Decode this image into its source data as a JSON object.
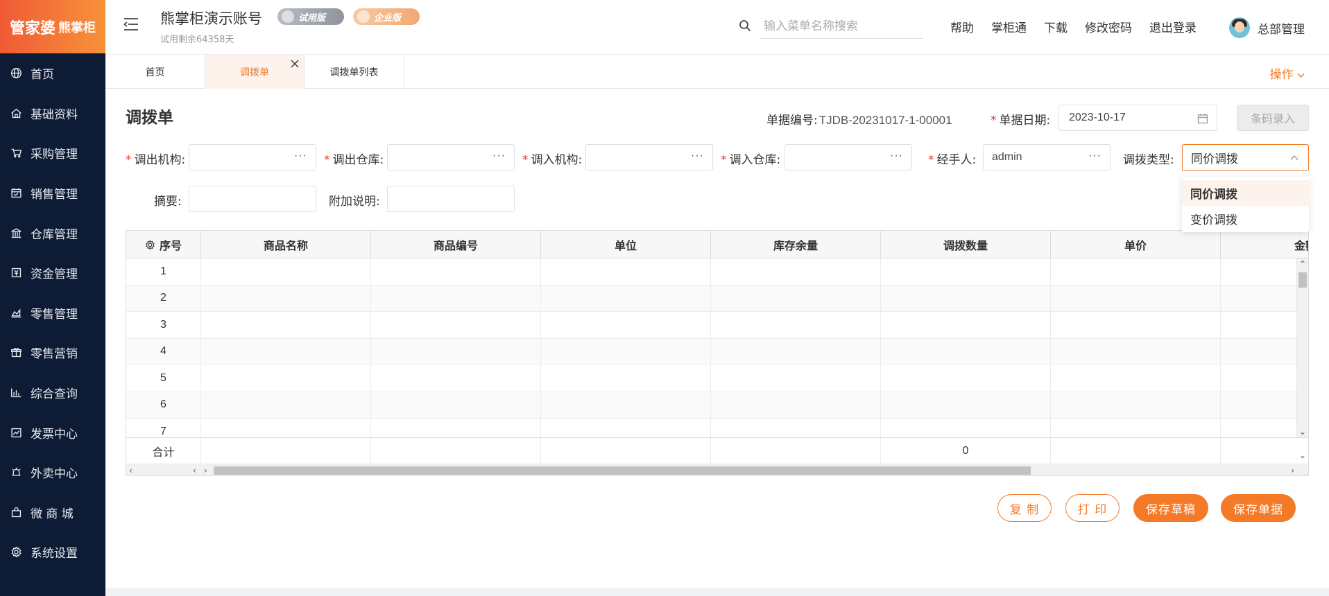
{
  "brand": {
    "logo_main": "管家婆",
    "logo_sub": "熊掌柜"
  },
  "sidebar": {
    "items": [
      {
        "label": "首页",
        "icon": "globe-icon"
      },
      {
        "label": "基础资料",
        "icon": "home-icon"
      },
      {
        "label": "采购管理",
        "icon": "cart-icon"
      },
      {
        "label": "销售管理",
        "icon": "calendar-icon"
      },
      {
        "label": "仓库管理",
        "icon": "warehouse-icon"
      },
      {
        "label": "资金管理",
        "icon": "money-icon"
      },
      {
        "label": "零售管理",
        "icon": "chart-area-icon"
      },
      {
        "label": "零售营销",
        "icon": "gift-icon"
      },
      {
        "label": "综合查询",
        "icon": "bar-chart-icon"
      },
      {
        "label": "发票中心",
        "icon": "trend-icon"
      },
      {
        "label": "外卖中心",
        "icon": "alarm-icon"
      },
      {
        "label": "微 商 城",
        "icon": "bag-icon"
      },
      {
        "label": "系统设置",
        "icon": "gear-icon"
      }
    ]
  },
  "header": {
    "account_title": "熊掌柜演示账号",
    "badge_trial": "试用版",
    "badge_enterprise": "企业版",
    "trial_remaining": "试用剩余64358天",
    "search_placeholder": "输入菜单名称搜索",
    "links": [
      "帮助",
      "掌柜通",
      "下载",
      "修改密码",
      "退出登录"
    ],
    "user_name": "总部管理"
  },
  "tabs": {
    "items": [
      "首页",
      "调拨单",
      "调拨单列表"
    ],
    "active": "调拨单",
    "ops_label": "操作"
  },
  "form": {
    "title": "调拨单",
    "doc_no_label": "单据编号:",
    "doc_no_value": "TJDB-20231017-1-00001",
    "date_label": "单据日期:",
    "date_value": "2023-10-17",
    "barcode_button": "条码录入",
    "out_org_label": "调出机构:",
    "out_wh_label": "调出仓库:",
    "in_org_label": "调入机构:",
    "in_wh_label": "调入仓库:",
    "handler_label": "经手人:",
    "handler_value": "admin",
    "type_label": "调拨类型:",
    "type_value": "同价调拨",
    "type_options": [
      "同价调拨",
      "变价调拨"
    ],
    "summary_label": "摘要:",
    "note_label": "附加说明:",
    "field_more": "···"
  },
  "grid": {
    "columns": [
      "序号",
      "商品名称",
      "商品编号",
      "单位",
      "库存余量",
      "调拨数量",
      "单价",
      "金额"
    ],
    "rows": [
      "1",
      "2",
      "3",
      "4",
      "5",
      "6",
      "7"
    ],
    "total_label": "合计",
    "total_qty": "0"
  },
  "actions": {
    "copy": "复 制",
    "print": "打 印",
    "save_draft": "保存草稿",
    "save_doc": "保存单据"
  },
  "colors": {
    "accent": "#f47a27",
    "sidebar_bg": "#0d1b35"
  }
}
